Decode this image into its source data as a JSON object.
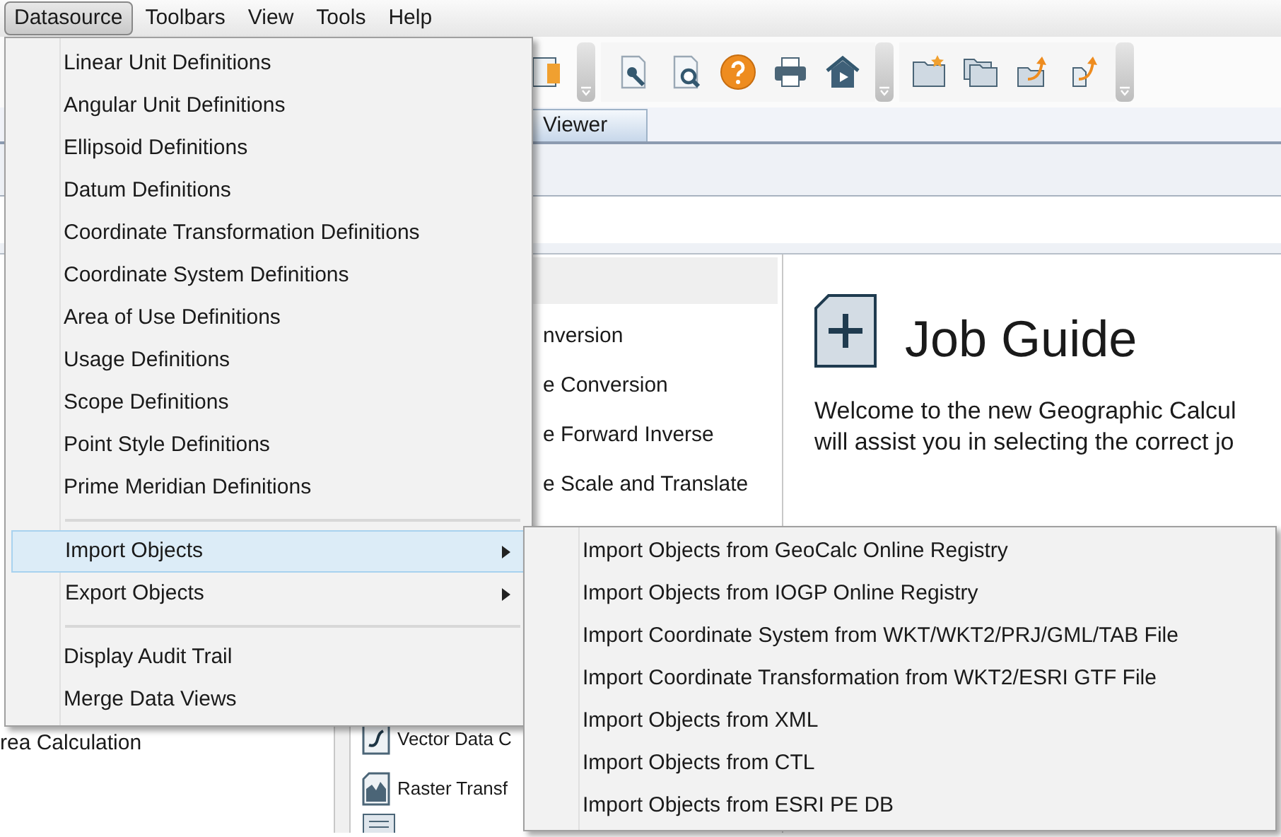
{
  "menubar": [
    {
      "label": "Datasource",
      "selected": true
    },
    {
      "label": "Toolbars",
      "selected": false
    },
    {
      "label": "View",
      "selected": false
    },
    {
      "label": "Tools",
      "selected": false
    },
    {
      "label": "Help",
      "selected": false
    }
  ],
  "tabs": [
    {
      "label": "Viewer"
    }
  ],
  "tree": [
    {
      "label": "rea Calculation"
    }
  ],
  "job_list_top": [
    {
      "label": "nversion"
    },
    {
      "label": "e Conversion"
    },
    {
      "label": "e Forward Inverse"
    },
    {
      "label": "e Scale and Translate"
    }
  ],
  "job_list_bottom": [
    {
      "label": "Vector Data C",
      "kind": "vector"
    },
    {
      "label": "Raster Transf",
      "kind": "raster"
    }
  ],
  "job_guide": {
    "title": "Job Guide",
    "lines": [
      "Welcome to the new Geographic Calcul",
      "will assist you in selecting the correct jo"
    ]
  },
  "datasource_menu": [
    {
      "kind": "item",
      "label": "Linear Unit Definitions"
    },
    {
      "kind": "item",
      "label": "Angular Unit Definitions"
    },
    {
      "kind": "item",
      "label": "Ellipsoid Definitions"
    },
    {
      "kind": "item",
      "label": "Datum Definitions"
    },
    {
      "kind": "item",
      "label": "Coordinate Transformation Definitions"
    },
    {
      "kind": "item",
      "label": "Coordinate System Definitions"
    },
    {
      "kind": "item",
      "label": "Area of Use Definitions"
    },
    {
      "kind": "item",
      "label": "Usage Definitions"
    },
    {
      "kind": "item",
      "label": "Scope Definitions"
    },
    {
      "kind": "item",
      "label": "Point Style Definitions"
    },
    {
      "kind": "item",
      "label": "Prime Meridian Definitions"
    },
    {
      "kind": "separator"
    },
    {
      "kind": "submenu",
      "label": "Import Objects",
      "selected": true
    },
    {
      "kind": "submenu",
      "label": "Export Objects",
      "selected": false
    },
    {
      "kind": "separator"
    },
    {
      "kind": "item",
      "label": "Display Audit Trail"
    },
    {
      "kind": "item",
      "label": "Merge Data Views"
    }
  ],
  "import_submenu": [
    {
      "label": "Import Objects from GeoCalc Online Registry"
    },
    {
      "label": "Import Objects from IOGP Online Registry"
    },
    {
      "label": "Import Coordinate System from WKT/WKT2/PRJ/GML/TAB File"
    },
    {
      "label": "Import Coordinate Transformation from WKT2/ESRI GTF File"
    },
    {
      "label": "Import Objects from XML"
    },
    {
      "label": "Import Objects from CTL"
    },
    {
      "label": "Import Objects from ESRI PE DB"
    }
  ]
}
